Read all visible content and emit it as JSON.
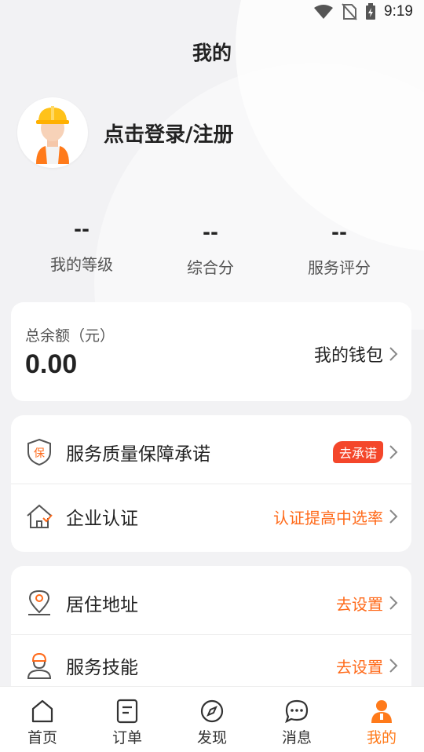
{
  "status_bar": {
    "time": "9:19"
  },
  "page": {
    "title": "我的"
  },
  "profile": {
    "login_text": "点击登录/注册"
  },
  "stats": [
    {
      "value": "--",
      "label": "我的等级"
    },
    {
      "value": "--",
      "label": "综合分"
    },
    {
      "value": "--",
      "label": "服务评分"
    }
  ],
  "wallet": {
    "label": "总余额（元）",
    "amount": "0.00",
    "link": "我的钱包"
  },
  "group1": [
    {
      "label": "服务质量保障承诺",
      "badge": "去承诺",
      "icon": "shield-bao-icon"
    },
    {
      "label": "企业认证",
      "hint": "认证提高中选率",
      "icon": "house-check-icon"
    }
  ],
  "group2": [
    {
      "label": "居住地址",
      "hint": "去设置",
      "icon": "location-icon"
    },
    {
      "label": "服务技能",
      "hint": "去设置",
      "icon": "worker-icon"
    }
  ],
  "tabs": [
    {
      "label": "首页",
      "icon": "home-icon"
    },
    {
      "label": "订单",
      "icon": "order-icon"
    },
    {
      "label": "发现",
      "icon": "compass-icon"
    },
    {
      "label": "消息",
      "icon": "message-icon"
    },
    {
      "label": "我的",
      "icon": "person-icon",
      "active": true
    }
  ],
  "colors": {
    "accent": "#ff7a1a",
    "badge": "#f4462a",
    "background": "#f2f2f4"
  }
}
